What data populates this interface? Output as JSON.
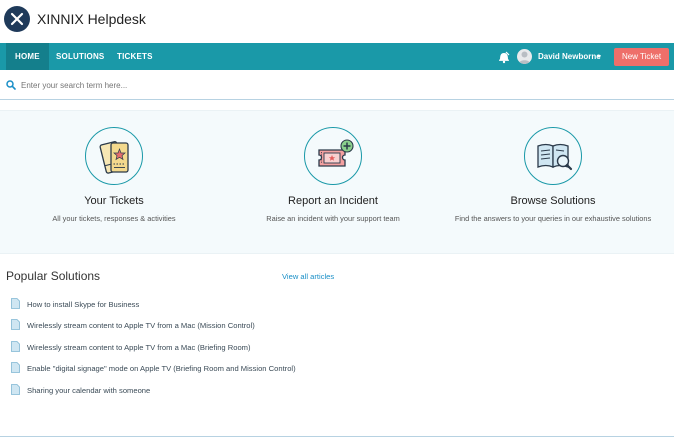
{
  "app": {
    "title": "XINNIX Helpdesk"
  },
  "nav": {
    "tabs": [
      {
        "label": "HOME",
        "active": true
      },
      {
        "label": "SOLUTIONS",
        "active": false
      },
      {
        "label": "TICKETS",
        "active": false
      }
    ],
    "user_name": "David Newborne",
    "new_ticket_label": "New Ticket"
  },
  "search": {
    "placeholder": "Enter your search term here..."
  },
  "features": [
    {
      "icon": "tickets-icon",
      "title": "Your Tickets",
      "description": "All your tickets, responses & activities"
    },
    {
      "icon": "incident-ticket-icon",
      "title": "Report an Incident",
      "description": "Raise an incident with your support team"
    },
    {
      "icon": "book-search-icon",
      "title": "Browse Solutions",
      "description": "Find the answers to your queries in our exhaustive solutions"
    }
  ],
  "popular": {
    "title": "Popular Solutions",
    "view_all_label": "View all articles",
    "items": [
      "How to install Skype for Business",
      "Wirelessly stream content to Apple TV from a Mac (Mission Control)",
      "Wirelessly stream content to Apple TV from a Mac (Briefing Room)",
      "Enable \"digital signage\" mode on Apple TV (Briefing Room and Mission Control)",
      "Sharing your calendar with someone"
    ]
  },
  "colors": {
    "accent": "#1a99a8",
    "accent_dark": "#147f8c",
    "button": "#ee6f6a",
    "link": "#1a8fc7",
    "logo": "#1f3a5a"
  }
}
